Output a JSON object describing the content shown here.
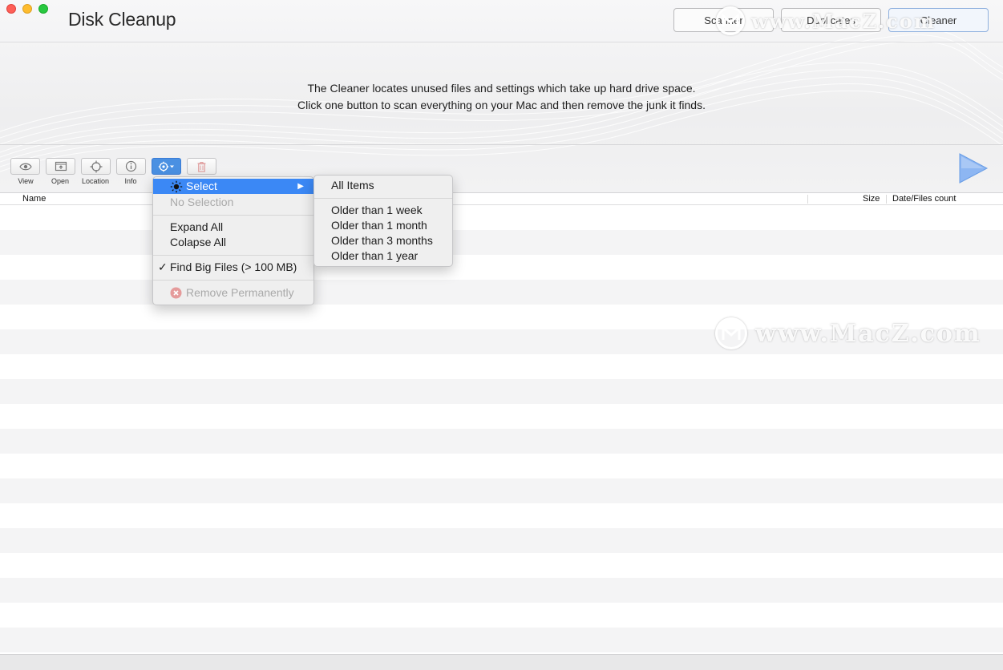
{
  "window": {
    "title": "Disk Cleanup"
  },
  "mode_buttons": [
    {
      "label": "Scanner"
    },
    {
      "label": "Duplicates"
    },
    {
      "label": "Cleaner"
    }
  ],
  "description": {
    "line1": "The Cleaner locates unused files and settings which take up hard drive space.",
    "line2": "Click one button to scan everything on your Mac and then remove the junk it finds."
  },
  "toolbar": {
    "view": {
      "label": "View",
      "icon": "eye-icon"
    },
    "open": {
      "label": "Open",
      "icon": "open-icon"
    },
    "location": {
      "label": "Location",
      "icon": "crosshair-icon"
    },
    "info": {
      "label": "Info",
      "icon": "info-icon"
    },
    "actions": {
      "icon": "gear-icon"
    },
    "delete": {
      "icon": "trash-icon"
    }
  },
  "table": {
    "columns": {
      "name": "Name",
      "size": "Size",
      "date": "Date/Files count"
    }
  },
  "action_menu": {
    "select": "Select",
    "no_selection": "No Selection",
    "expand_all": "Expand All",
    "collapse_all": "Colapse All",
    "find_big_files": "Find Big Files (> 100 MB)",
    "find_big_files_checked": true,
    "remove_permanently": "Remove Permanently"
  },
  "select_submenu": {
    "all_items": "All Items",
    "options": [
      "Older than 1 week",
      "Older than 1 month",
      "Older than 3 months",
      "Older than 1 year"
    ]
  },
  "watermark": {
    "text": "www.MacZ.com"
  },
  "colors": {
    "menu_highlight": "#3b88f5",
    "play_arrow": "#8db6f2"
  }
}
